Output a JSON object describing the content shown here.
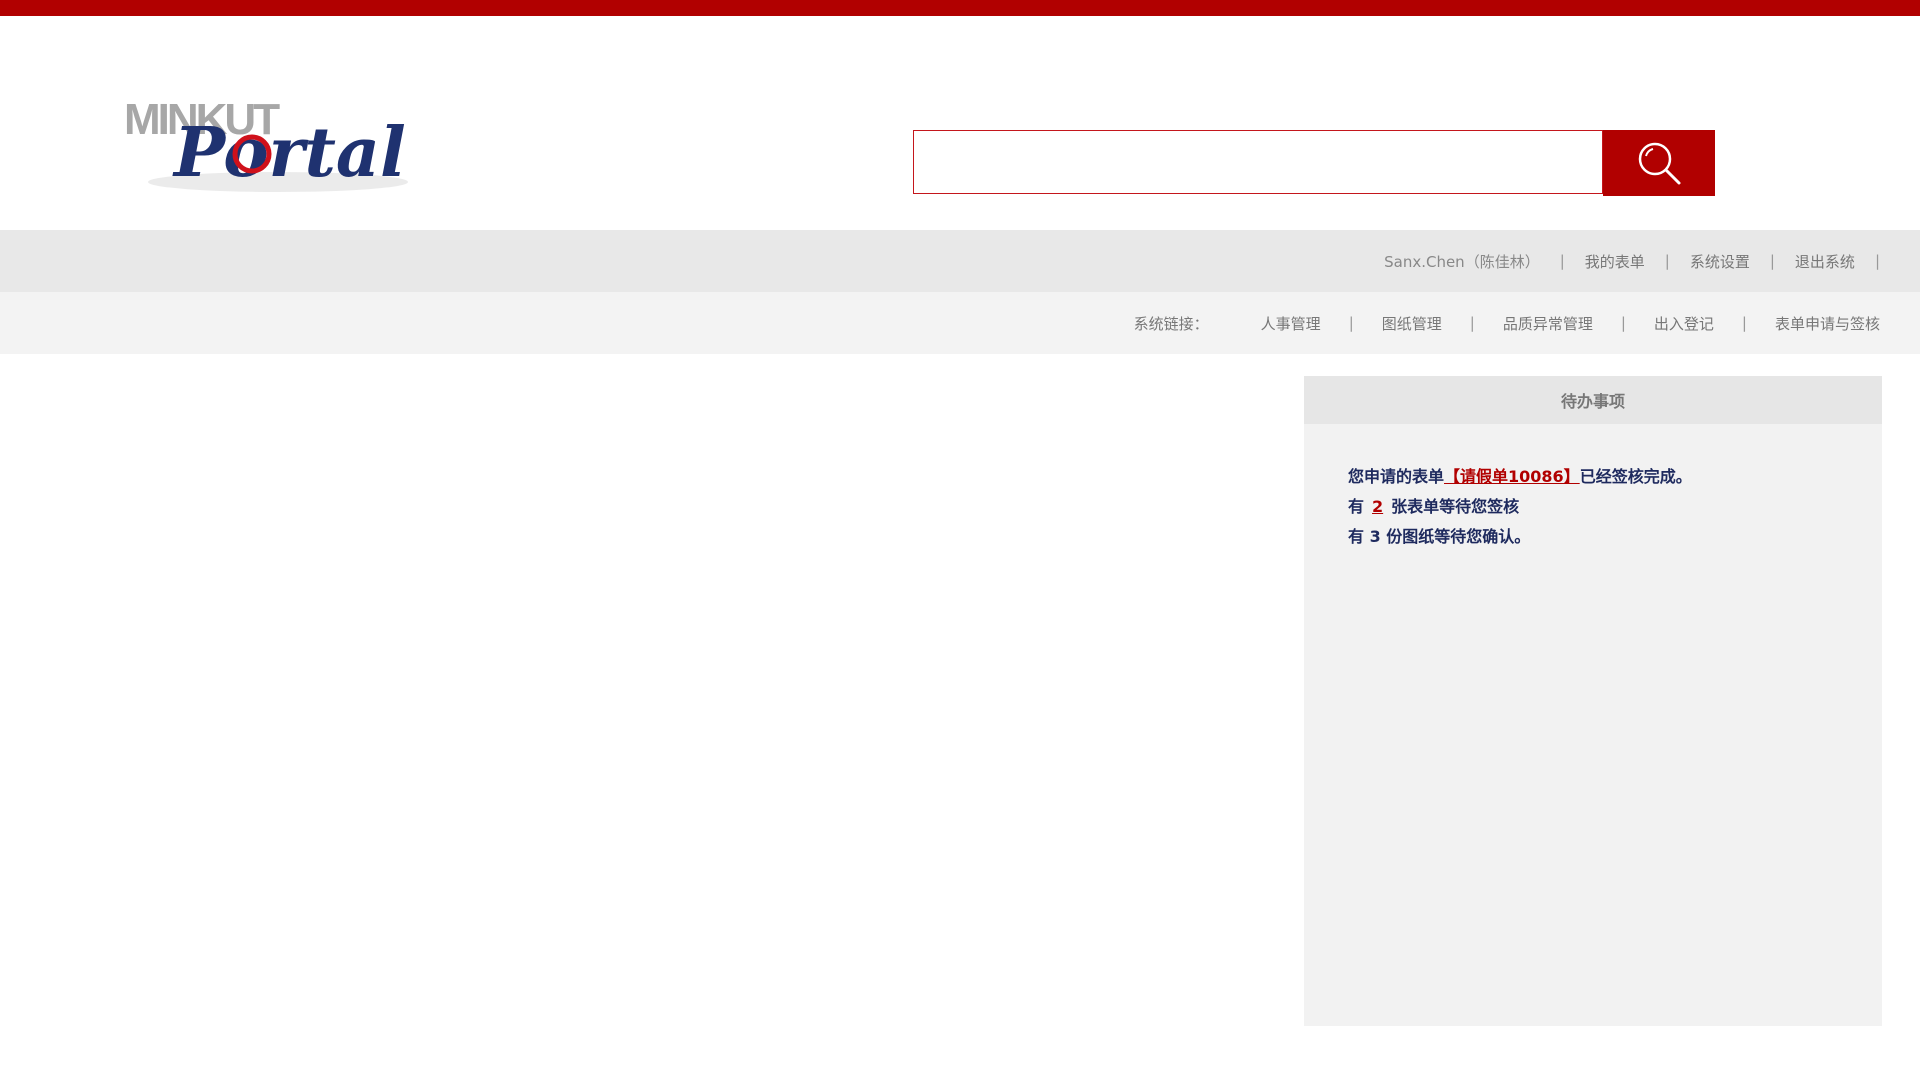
{
  "logo": {
    "brand_top": "MINKUT",
    "brand_main": "Portal"
  },
  "search": {
    "value": "",
    "placeholder": ""
  },
  "user_bar": {
    "user": "Sanx.Chen（陈佳林）",
    "separator": "|",
    "my_forms": "我的表单",
    "settings": "系统设置",
    "logout": "退出系统"
  },
  "link_bar": {
    "label": "系统链接：",
    "links": [
      "人事管理",
      "图纸管理",
      "品质异常管理",
      "出入登记",
      "表单申请与签核"
    ]
  },
  "todo_panel": {
    "title": "待办事项",
    "line1_prefix": "您申请的表单",
    "line1_link": "【请假单10086】",
    "line1_suffix": "已经签核完成。",
    "line2_prefix": "有",
    "line2_count": "2",
    "line2_suffix": "张表单等待您签核",
    "line3": "有 3 份图纸等待您确认。"
  },
  "colors": {
    "brand_red": "#b10000",
    "nav_gray": "#e8e8e8",
    "text_navy": "#1e2a5e"
  }
}
